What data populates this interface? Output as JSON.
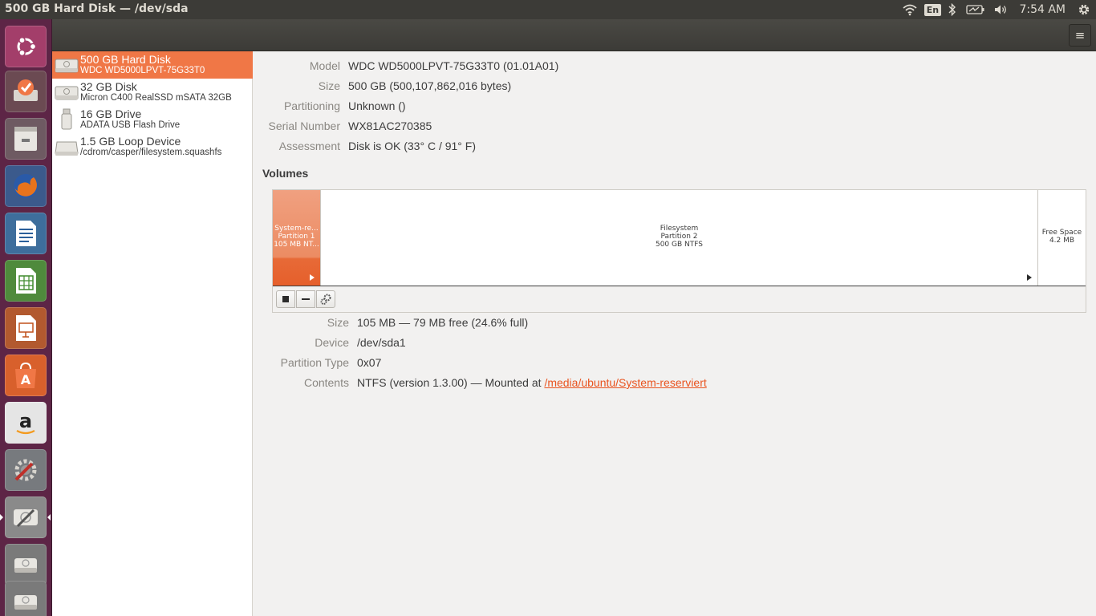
{
  "panel": {
    "window_title": "500 GB Hard Disk — /dev/sda",
    "keyboard_layout": "En",
    "clock": "7:54 AM",
    "indicator_icons": [
      "wifi-icon",
      "bluetooth-icon",
      "battery-icon",
      "volume-icon",
      "settings-gear-icon"
    ]
  },
  "launcher": {
    "items": [
      {
        "name": "ubuntu-dash-icon"
      },
      {
        "name": "system-update-icon"
      },
      {
        "name": "files-icon"
      },
      {
        "name": "firefox-icon"
      },
      {
        "name": "writer-icon"
      },
      {
        "name": "calc-icon"
      },
      {
        "name": "impress-icon"
      },
      {
        "name": "software-center-icon"
      },
      {
        "name": "amazon-icon"
      },
      {
        "name": "system-settings-icon"
      },
      {
        "name": "disks-icon",
        "active": true
      },
      {
        "name": "drive-icon"
      },
      {
        "name": "drive-icon"
      }
    ]
  },
  "headerbar": {
    "menu_icon": "hamburger-menu-icon"
  },
  "devices": [
    {
      "name": "500 GB Hard Disk",
      "desc": "WDC WD5000LPVT-75G33T0",
      "icon": "hard-disk-icon",
      "selected": true
    },
    {
      "name": "32 GB Disk",
      "desc": "Micron C400 RealSSD mSATA 32GB",
      "icon": "hard-disk-icon",
      "selected": false
    },
    {
      "name": "16 GB Drive",
      "desc": "ADATA USB Flash Drive",
      "icon": "usb-drive-icon",
      "selected": false
    },
    {
      "name": "1.5 GB Loop Device",
      "desc": "/cdrom/casper/filesystem.squashfs",
      "icon": "loop-device-icon",
      "selected": false
    }
  ],
  "disk_info": [
    {
      "label": "Model",
      "value": "WDC WD5000LPVT-75G33T0 (01.01A01)"
    },
    {
      "label": "Size",
      "value": "500 GB (500,107,862,016 bytes)"
    },
    {
      "label": "Partitioning",
      "value": "Unknown ()"
    },
    {
      "label": "Serial Number",
      "value": "WX81AC270385"
    },
    {
      "label": "Assessment",
      "value": "Disk is OK (33° C / 91° F)"
    }
  ],
  "volumes": {
    "title": "Volumes",
    "segments": [
      {
        "line1": "System-re...",
        "line2": "Partition 1",
        "line3": "105 MB NT...",
        "selected": true
      },
      {
        "line1": "Filesystem",
        "line2": "Partition 2",
        "line3": "500 GB NTFS",
        "selected": false
      },
      {
        "line1": "Free Space",
        "line2": "4.2 MB",
        "selected": false
      }
    ],
    "toolbar_icons": [
      "stop-icon",
      "minus-icon",
      "gears-icon"
    ]
  },
  "volume_info": [
    {
      "label": "Size",
      "value": "105 MB — 79 MB free (24.6% full)"
    },
    {
      "label": "Device",
      "value": "/dev/sda1"
    },
    {
      "label": "Partition Type",
      "value": "0x07"
    },
    {
      "label": "Contents",
      "value": "NTFS (version 1.3.00) — Mounted at",
      "link": "/media/ubuntu/System-reserviert"
    }
  ],
  "colors": {
    "accent": "#e95420",
    "selection": "#f07746",
    "launcher": "#5d2546",
    "panel": "#3c3b37"
  }
}
